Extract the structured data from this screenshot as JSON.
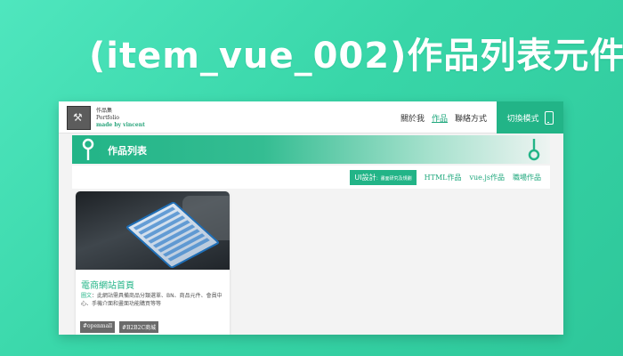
{
  "hero": {
    "title": "(item_vue_002)作品列表元件"
  },
  "header": {
    "logo_caption": "Vincent T.",
    "brand_line1": "作品集",
    "brand_line2": "Portfolio",
    "brand_line3": "made by vincent",
    "nav": [
      "關於我",
      "作品",
      "聯絡方式"
    ],
    "active_nav": "作品",
    "switch_label": "切換模式"
  },
  "section": {
    "title": "作品列表"
  },
  "filters": {
    "active_main": "UI設計",
    "active_sub": "：畫面研究及規劃",
    "items": [
      "HTML作品",
      "vue.js作品",
      "職場作品"
    ]
  },
  "card": {
    "title": "電商網站首頁",
    "desc_label": "圖文",
    "desc_text": "：此網站需具備商品分類選單、BN、商品元件、會員中心、手機介面和畫面功能購買等等",
    "tags": [
      "#openmall",
      "#B2B2C商城"
    ]
  },
  "colors": {
    "accent": "#22b487",
    "background_gradient_start": "#4fe6be",
    "tag_bg": "#6a6a6a"
  }
}
